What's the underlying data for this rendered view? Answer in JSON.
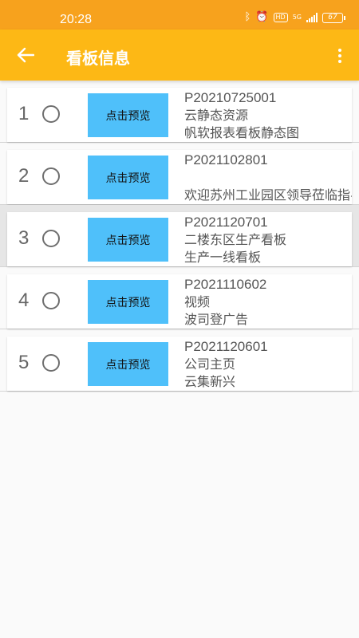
{
  "status": {
    "time": "20:28",
    "network": "5G",
    "battery": "67",
    "hd": "HD"
  },
  "appbar": {
    "title": "看板信息"
  },
  "boards": [
    {
      "index": "1",
      "button": "点击预览",
      "code": "P20210725001",
      "name": "云静态资源",
      "desc": "帆软报表看板静态图"
    },
    {
      "index": "2",
      "button": "点击预览",
      "code": "P2021102801",
      "name": "",
      "desc": "欢迎苏州工业园区领导莅临指导"
    },
    {
      "index": "3",
      "button": "点击预览",
      "code": "P2021120701",
      "name": "二楼东区生产看板",
      "desc": "生产一线看板"
    },
    {
      "index": "4",
      "button": "点击预览",
      "code": "P2021110602",
      "name": "视频",
      "desc": "波司登广告"
    },
    {
      "index": "5",
      "button": "点击预览",
      "code": "P2021120601",
      "name": "公司主页",
      "desc": "云集新兴"
    }
  ],
  "colors": {
    "statusbar": "#f7a21d",
    "appbar": "#fdb815",
    "button": "#4fc0fa",
    "selected_row": "#e6e6e6"
  }
}
